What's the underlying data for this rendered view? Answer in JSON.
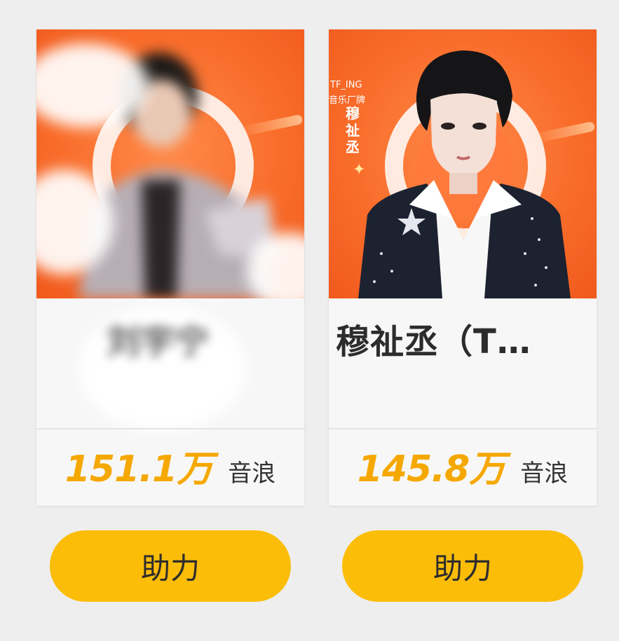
{
  "cards": [
    {
      "name": "刘宇宁",
      "value": "151.1万",
      "unit": "音浪",
      "button_label": "助力",
      "photo": "blurred-artist-photo"
    },
    {
      "name": "穆祉丞（T…",
      "value": "145.8万",
      "unit": "音浪",
      "button_label": "助力",
      "photo": "artist-photo",
      "poster": {
        "brand_line1": "TF_ING",
        "brand_line2": "音乐厂牌",
        "artist_name": "穆祉丞"
      }
    }
  ],
  "colors": {
    "accent": "#f5a800",
    "button": "#fbbd08",
    "poster_orange": "#f96d2b"
  }
}
